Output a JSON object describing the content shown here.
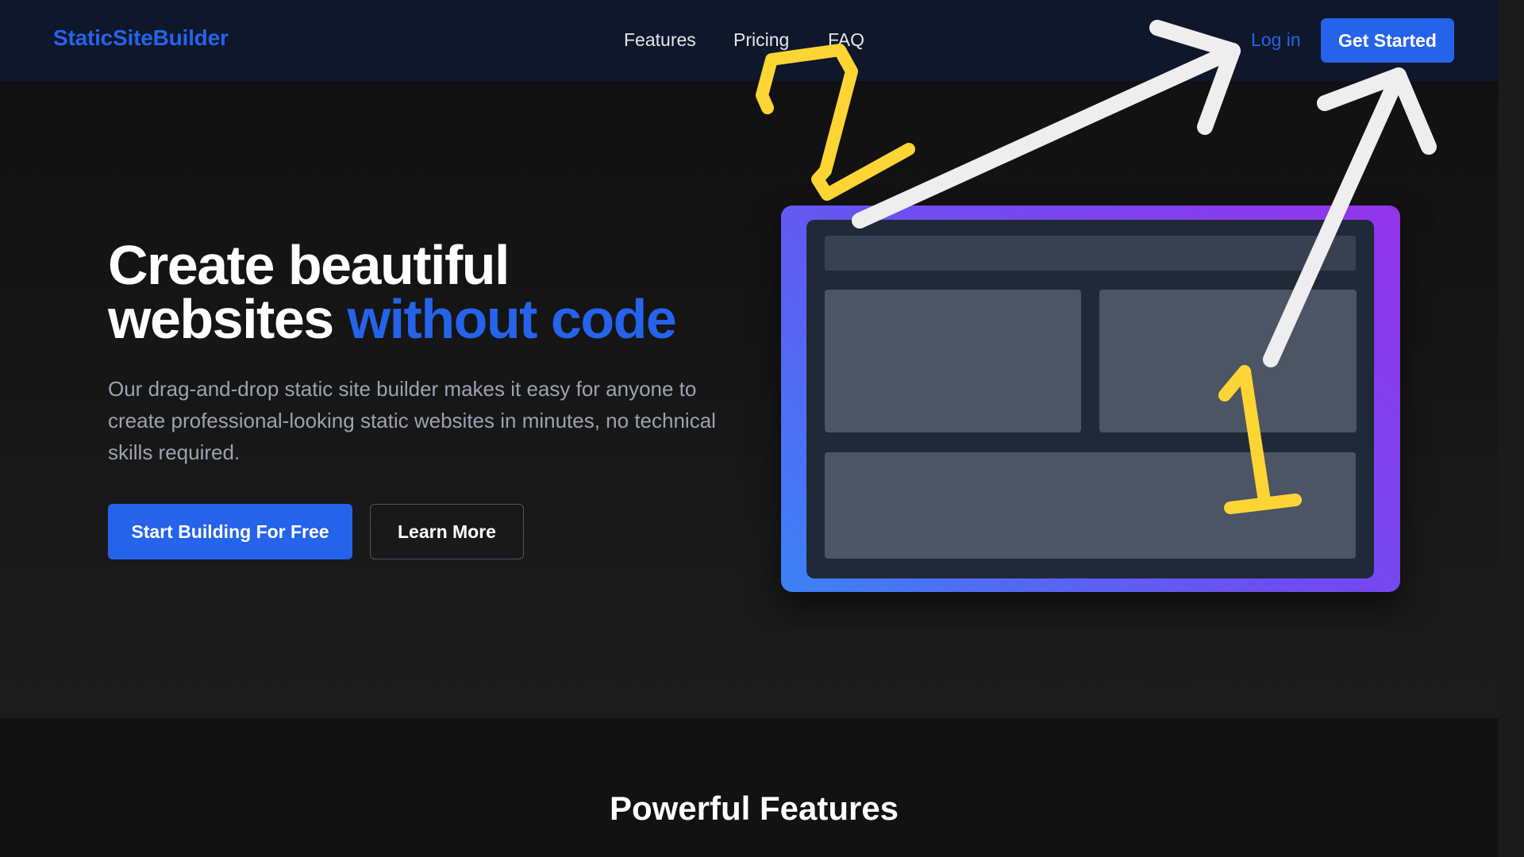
{
  "nav": {
    "brand": "StaticSiteBuilder",
    "links": [
      "Features",
      "Pricing",
      "FAQ"
    ],
    "login_label": "Log in",
    "cta_label": "Get Started"
  },
  "hero": {
    "title_line1": "Create beautiful",
    "title_line2_plain": "websites",
    "title_line2_accent": "without code",
    "description": "Our drag-and-drop static site builder makes it easy for anyone to create professional-looking static websites in minutes, no technical skills required.",
    "primary_button": "Start Building For Free",
    "secondary_button": "Learn More"
  },
  "features": {
    "title": "Powerful Features"
  },
  "colors": {
    "accent": "#2563eb",
    "navbar_bg": "#0f172a",
    "annotation_yellow": "#fcd535",
    "annotation_white": "#eeeeee"
  },
  "annotations": {
    "number_1": "1",
    "number_2": "2"
  }
}
